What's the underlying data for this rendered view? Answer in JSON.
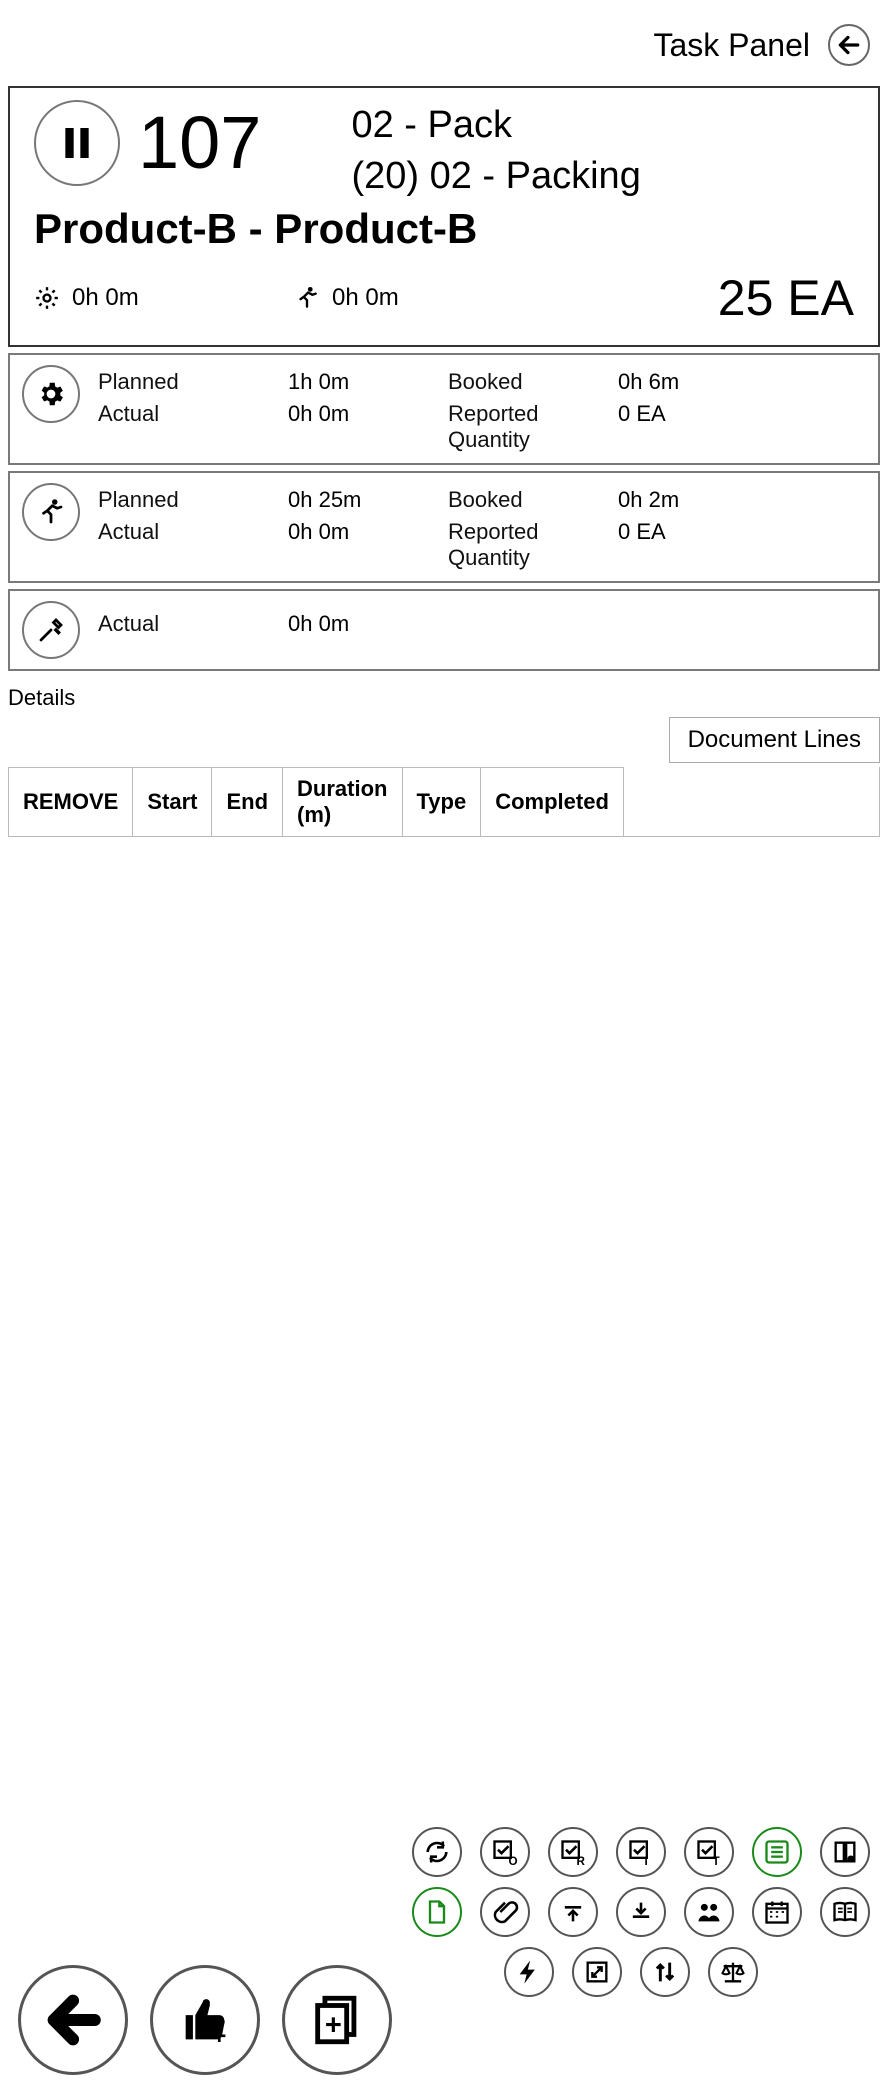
{
  "header": {
    "title": "Task Panel"
  },
  "task": {
    "id": "107",
    "op_line1": "02 - Pack",
    "op_line2": "(20) 02 - Packing",
    "product": "Product-B - Product-B",
    "summary": {
      "setup": "0h 0m",
      "labor": "0h 0m",
      "quantity": "25 EA"
    }
  },
  "sections": [
    {
      "icon": "gear",
      "planned": "1h 0m",
      "booked": "0h 6m",
      "actual": "0h 0m",
      "rq": "0 EA",
      "full": true
    },
    {
      "icon": "runner",
      "planned": "0h 25m",
      "booked": "0h 2m",
      "actual": "0h 0m",
      "rq": "0 EA",
      "full": true
    },
    {
      "icon": "tools",
      "actual": "0h 0m",
      "full": false
    }
  ],
  "labels": {
    "planned": "Planned",
    "booked": "Booked",
    "actual": "Actual",
    "rq": "Reported Quantity",
    "details": "Details",
    "doc_lines": "Document Lines"
  },
  "table": {
    "headers": [
      "REMOVE",
      "Start",
      "End",
      "Duration (m)",
      "Type",
      "Completed"
    ]
  }
}
